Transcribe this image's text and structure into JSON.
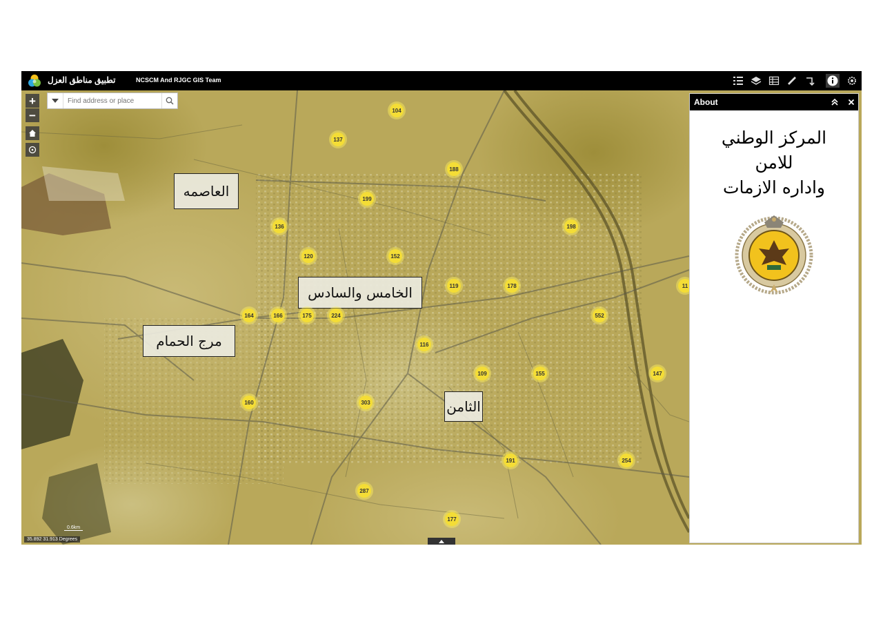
{
  "header": {
    "app_title": "تطبيق مناطق العزل",
    "subtitle": "NCSCM And RJGC GIS Team"
  },
  "toolbar": {
    "tools": [
      "legend-icon",
      "layers-icon",
      "attribute-table-icon",
      "measure-icon",
      "directions-icon",
      "info-icon",
      "settings-icon"
    ]
  },
  "search": {
    "placeholder": "Find address or place"
  },
  "map_controls": {
    "zoom_in": "+",
    "zoom_out": "−"
  },
  "regions": {
    "capital": "العاصمه",
    "fifth_sixth": "الخامس والسادس",
    "marj": "مرج الحمام",
    "eighth": "الثامن"
  },
  "clusters": [
    "104",
    "137",
    "188",
    "199",
    "136",
    "198",
    "120",
    "152",
    "119",
    "178",
    "11",
    "164",
    "166",
    "175",
    "224",
    "552",
    "116",
    "109",
    "155",
    "147",
    "160",
    "303",
    "191",
    "254",
    "287",
    "177"
  ],
  "status": {
    "coordinates": "35.892 31.913 Degrees",
    "scale": "0.6km"
  },
  "about_panel": {
    "title": "About",
    "org_line1": "المركز الوطني",
    "org_line2": "للامن",
    "org_line3": "واداره الازمات"
  },
  "colors": {
    "header_bg": "#000000",
    "cluster_fill": "#f4dd36",
    "map_tone": "#b9a85a"
  }
}
